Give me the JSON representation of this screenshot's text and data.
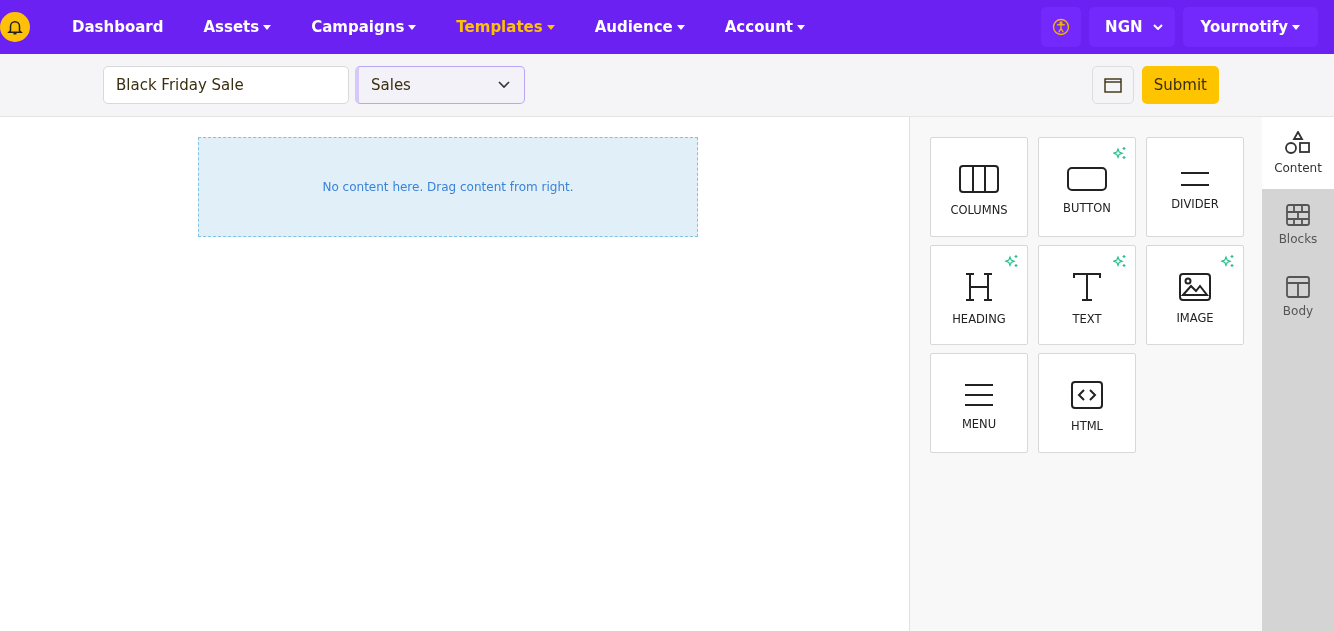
{
  "nav": {
    "items": [
      {
        "label": "Dashboard",
        "selected": false,
        "dropdown": false
      },
      {
        "label": "Assets",
        "selected": false,
        "dropdown": true
      },
      {
        "label": "Campaigns",
        "selected": false,
        "dropdown": true
      },
      {
        "label": "Templates",
        "selected": true,
        "dropdown": true
      },
      {
        "label": "Audience",
        "selected": false,
        "dropdown": true
      },
      {
        "label": "Account",
        "selected": false,
        "dropdown": true
      }
    ],
    "currency": "NGN",
    "user": "Yournotify"
  },
  "toolbar": {
    "name": "Black Friday Sale",
    "category": "Sales",
    "submit": "Submit"
  },
  "canvas": {
    "empty_message": "No content here. Drag content from right."
  },
  "tools": [
    {
      "kind": "columns",
      "label": "COLUMNS",
      "ai": false
    },
    {
      "kind": "button",
      "label": "BUTTON",
      "ai": true
    },
    {
      "kind": "divider",
      "label": "DIVIDER",
      "ai": false
    },
    {
      "kind": "heading",
      "label": "HEADING",
      "ai": true
    },
    {
      "kind": "text",
      "label": "TEXT",
      "ai": true
    },
    {
      "kind": "image",
      "label": "IMAGE",
      "ai": true
    },
    {
      "kind": "menu",
      "label": "MENU",
      "ai": false
    },
    {
      "kind": "html",
      "label": "HTML",
      "ai": false
    }
  ],
  "side_tabs": [
    {
      "kind": "content",
      "label": "Content",
      "selected": true
    },
    {
      "kind": "blocks",
      "label": "Blocks",
      "selected": false
    },
    {
      "kind": "body",
      "label": "Body",
      "selected": false
    }
  ]
}
